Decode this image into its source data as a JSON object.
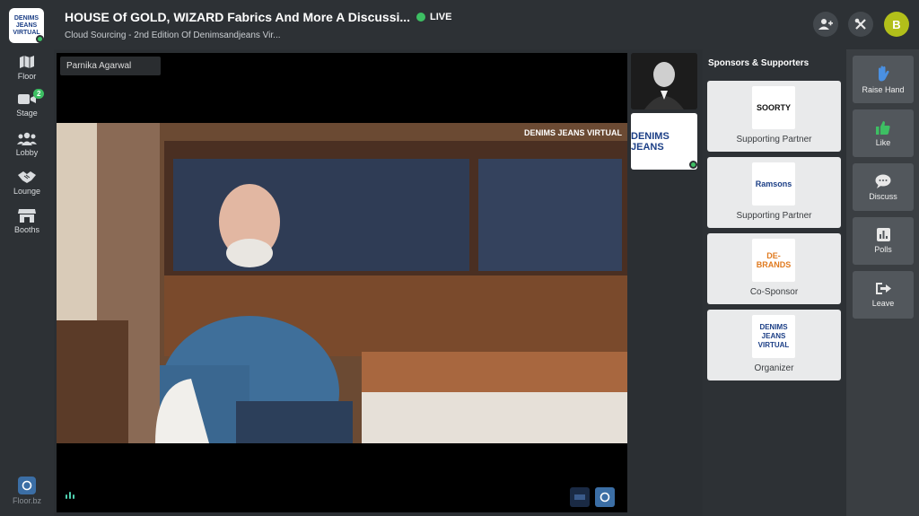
{
  "header": {
    "logo_text": "DENIMS JEANS VIRTUAL",
    "title": "HOUSE Of GOLD, WIZARD Fabrics And More A Discussi...",
    "live_label": "LIVE",
    "subtitle": "Cloud Sourcing - 2nd Edition Of Denimsandjeans Vir...",
    "avatar_letter": "B",
    "colors": {
      "live": "#3dbf63",
      "avatar": "#b2bf1a"
    }
  },
  "nav": {
    "items": [
      {
        "label": "Floor",
        "icon": "map-icon"
      },
      {
        "label": "Stage",
        "icon": "video-camera-icon",
        "badge": "2"
      },
      {
        "label": "Lobby",
        "icon": "people-group-icon"
      },
      {
        "label": "Lounge",
        "icon": "handshake-icon"
      },
      {
        "label": "Booths",
        "icon": "booth-store-icon"
      }
    ],
    "brand_label": "Floor.bz"
  },
  "video": {
    "speaker_name": "Parnika Agarwal",
    "watermark": "DENIMS JEANS VIRTUAL"
  },
  "participants": {
    "logo_text": "DENIMS JEANS"
  },
  "sponsors": {
    "title": "Sponsors & Supporters",
    "items": [
      {
        "logo": "SOORTY",
        "label": "Supporting Partner"
      },
      {
        "logo": "Ramsons",
        "label": "Supporting Partner"
      },
      {
        "logo": "DE-BRANDS",
        "label": "Co-Sponsor"
      },
      {
        "logo": "DENIMS JEANS VIRTUAL",
        "label": "Organizer"
      }
    ]
  },
  "actions": {
    "items": [
      {
        "label": "Raise Hand",
        "icon": "raise-hand-icon"
      },
      {
        "label": "Like",
        "icon": "thumbs-up-icon"
      },
      {
        "label": "Discuss",
        "icon": "chat-bubble-icon"
      },
      {
        "label": "Polls",
        "icon": "bar-chart-icon"
      },
      {
        "label": "Leave",
        "icon": "exit-icon"
      }
    ]
  }
}
